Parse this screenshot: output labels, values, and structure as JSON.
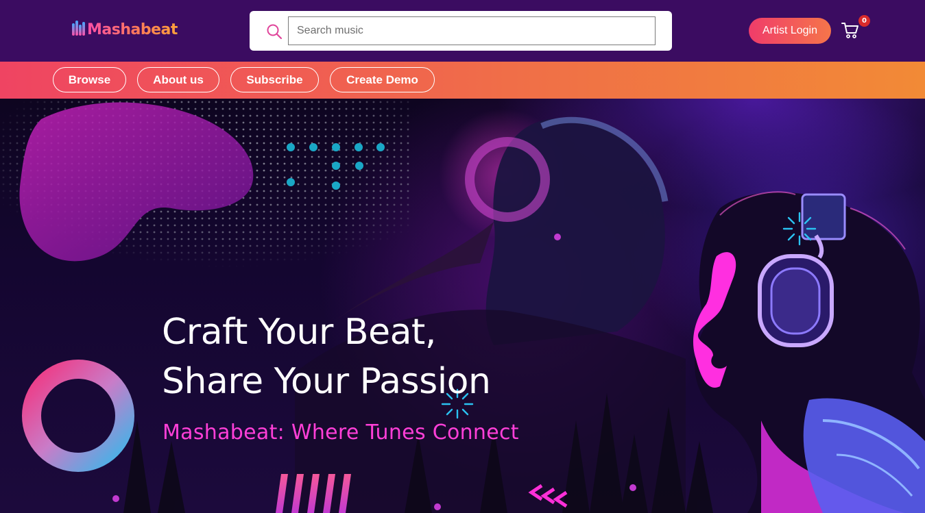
{
  "header": {
    "logo_text": "Mashabeat",
    "search": {
      "placeholder": "Search music",
      "value": ""
    },
    "artist_login_label": "Artist Login",
    "cart_count": "0"
  },
  "nav": {
    "items": [
      {
        "label": "Browse"
      },
      {
        "label": "About us"
      },
      {
        "label": "Subscribe"
      },
      {
        "label": "Create Demo"
      }
    ]
  },
  "hero": {
    "title_line1": "Craft Your Beat,",
    "title_line2": "Share Your Passion",
    "subtitle": "Mashabeat: Where Tunes Connect"
  },
  "colors": {
    "header_bg": "#3b0c61",
    "nav_gradient_start": "#ef4462",
    "nav_gradient_end": "#f28a36",
    "accent_magenta": "#ff3fd8",
    "badge_red": "#d92b2b"
  },
  "icons": {
    "search": "search-icon",
    "cart": "cart-icon"
  }
}
